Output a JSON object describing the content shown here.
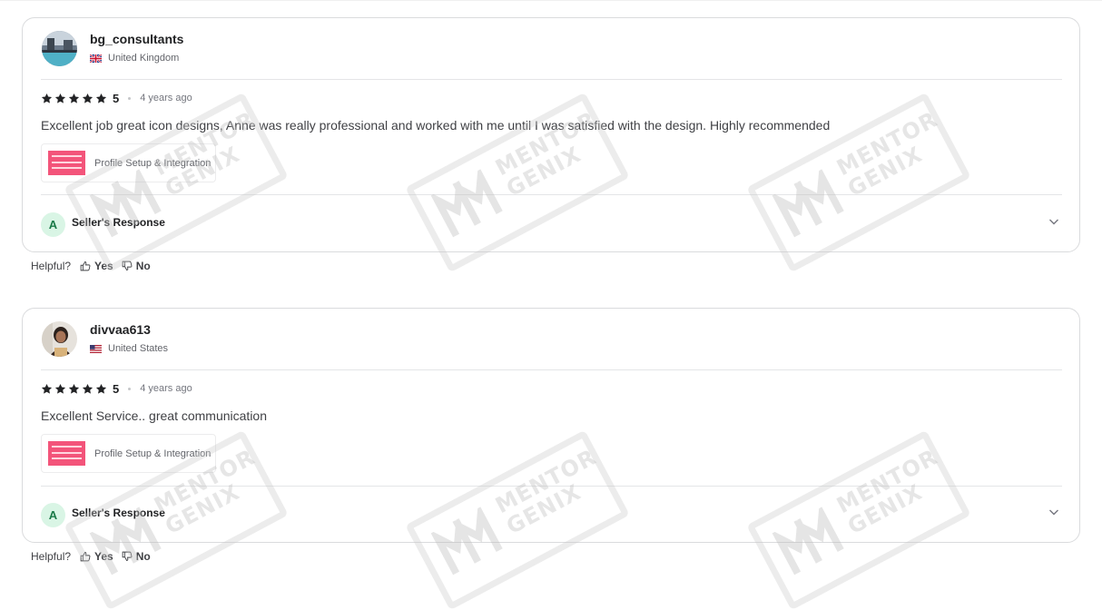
{
  "reviews": [
    {
      "username": "bg_consultants",
      "country": "United Kingdom",
      "rating": "5",
      "rating_value": 5,
      "time": "4 years ago",
      "text": "Excellent job great icon designs, Anne was really professional and worked with me until I was satisfied with the design. Highly recommended",
      "service": "Profile Setup & Integration",
      "response_initial": "A",
      "response_label": "Seller's Response"
    },
    {
      "username": "divvaa613",
      "country": "United States",
      "rating": "5",
      "rating_value": 5,
      "time": "4 years ago",
      "text": "Excellent Service.. great communication",
      "service": "Profile Setup & Integration",
      "response_initial": "A",
      "response_label": "Seller's Response"
    }
  ],
  "helpful": {
    "label": "Helpful?",
    "yes": "Yes",
    "no": "No"
  },
  "watermark": {
    "line1": "MENTOR",
    "line2": "GENIX"
  },
  "colors": {
    "star": "#222325",
    "response_badge_bg": "#d9f5e5",
    "response_badge_fg": "#1a7a48",
    "service_thumb": "#f3547a"
  }
}
